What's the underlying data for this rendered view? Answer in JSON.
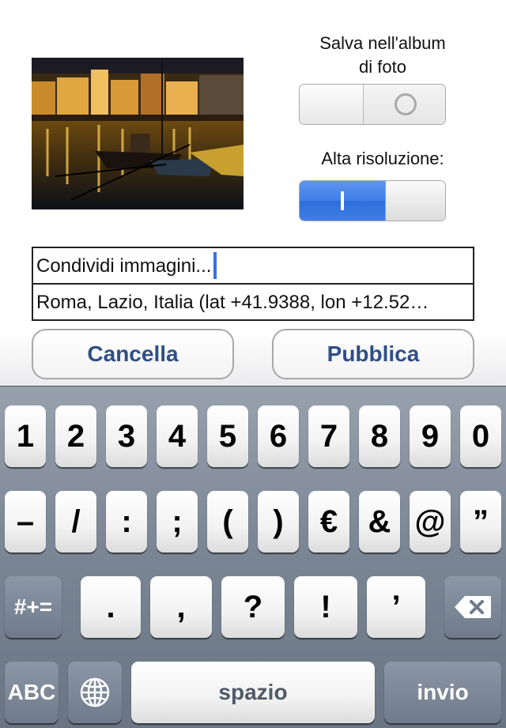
{
  "save_album": {
    "label_line1": "Salva nell'album",
    "label_line2": "di foto",
    "state": "off"
  },
  "high_res": {
    "label": "Alta risoluzione:",
    "state": "on"
  },
  "caption": {
    "value": "Condividi immagini..."
  },
  "location": {
    "value": "Roma, Lazio, Italia (lat +41.9388, lon +12.52…"
  },
  "buttons": {
    "cancel": "Cancella",
    "publish": "Pubblica"
  },
  "keyboard": {
    "row1": [
      "1",
      "2",
      "3",
      "4",
      "5",
      "6",
      "7",
      "8",
      "9",
      "0"
    ],
    "row2": [
      "–",
      "/",
      ":",
      ";",
      "(",
      ")",
      "€",
      "&",
      "@",
      "”"
    ],
    "row3": [
      ".",
      ",",
      "?",
      "!",
      "’"
    ],
    "symbols_key": "#+=",
    "abc_key": "ABC",
    "space_key": "spazio",
    "return_key": "invio"
  },
  "colors": {
    "accent": "#3f7ee6",
    "button_text": "#2f4e88",
    "keyboard_bg": "#7c8796"
  }
}
